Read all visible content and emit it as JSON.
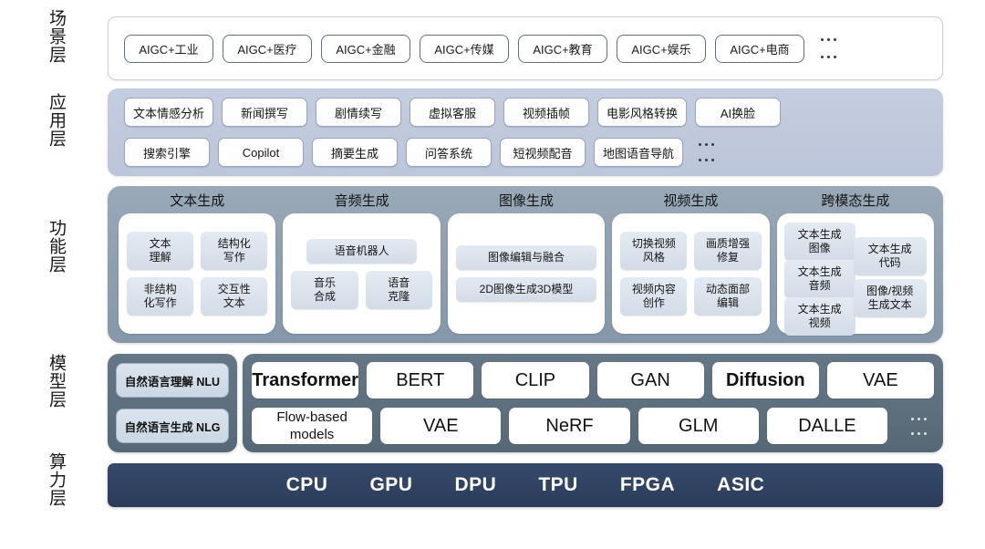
{
  "layers": [
    {
      "id": "scene",
      "label": "场景层"
    },
    {
      "id": "app",
      "label": "应用层"
    },
    {
      "id": "function",
      "label": "功能层"
    },
    {
      "id": "model",
      "label": "模型层"
    },
    {
      "id": "compute",
      "label": "算力层"
    }
  ],
  "scene": {
    "items": [
      "AIGC+工业",
      "AIGC+医疗",
      "AIGC+金融",
      "AIGC+传媒",
      "AIGC+教育",
      "AIGC+娱乐",
      "AIGC+电商"
    ],
    "more": "..."
  },
  "application": {
    "row1": [
      "文本情感分析",
      "新闻撰写",
      "剧情续写",
      "虚拟客服",
      "视频插帧",
      "电影风格转换",
      "AI换脸"
    ],
    "row2": [
      "搜索引擎",
      "Copilot",
      "摘要生成",
      "问答系统",
      "短视频配音",
      "地图语音导航"
    ],
    "more": "..."
  },
  "function": {
    "columns": [
      {
        "title": "文本生成",
        "rows": [
          [
            "文本\n理解",
            "结构化\n写作"
          ],
          [
            "非结构\n化写作",
            "交互性\n文本"
          ]
        ]
      },
      {
        "title": "音频生成",
        "rows": [
          [
            "语音机器人"
          ],
          [
            "音乐\n合成",
            "语音\n克隆"
          ]
        ]
      },
      {
        "title": "图像生成",
        "rows": [
          [
            "图像编辑与融合"
          ],
          [
            "2D图像生成3D模型"
          ]
        ]
      },
      {
        "title": "视频生成",
        "rows": [
          [
            "切换视频\n风格",
            "画质增强\n修复"
          ],
          [
            "视频内容\n创作",
            "动态面部\n编辑"
          ]
        ]
      },
      {
        "title": "跨模态生成",
        "cross": [
          "文本生成\n图像",
          "文本生成\n音频",
          "文本生成\n视频",
          "文本生成\n代码",
          "图像/视频\n生成文本"
        ]
      }
    ]
  },
  "model": {
    "left": [
      "自然语言理解 NLU",
      "自然语言生成 NLG"
    ],
    "row1": [
      {
        "label": "Transformer",
        "bold": true,
        "small": false
      },
      {
        "label": "BERT",
        "bold": false,
        "small": false
      },
      {
        "label": "CLIP",
        "bold": false,
        "small": false
      },
      {
        "label": "GAN",
        "bold": false,
        "small": false
      },
      {
        "label": "Diffusion",
        "bold": true,
        "small": false
      },
      {
        "label": "VAE",
        "bold": false,
        "small": false
      }
    ],
    "row2": [
      {
        "label": "Flow-based\nmodels",
        "bold": false,
        "small": true
      },
      {
        "label": "VAE",
        "bold": false,
        "small": false
      },
      {
        "label": "NeRF",
        "bold": false,
        "small": false
      },
      {
        "label": "GLM",
        "bold": false,
        "small": false
      },
      {
        "label": "DALLE",
        "bold": false,
        "small": false
      }
    ],
    "more": "..."
  },
  "compute": {
    "items": [
      "CPU",
      "GPU",
      "DPU",
      "TPU",
      "FPGA",
      "ASIC"
    ]
  },
  "colors": {
    "scene_bg": "#ffffff",
    "app_bg": "#c0c8dc",
    "function_bg": "#8e9fb0",
    "model_bg": "#5d6f7d",
    "compute_bg": "#2f4261",
    "tag_bg": "#d7dfe8"
  }
}
